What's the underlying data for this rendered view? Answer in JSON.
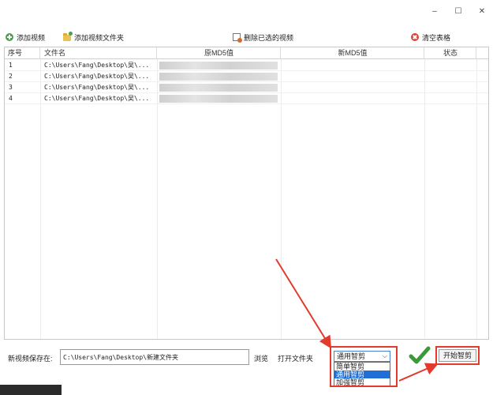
{
  "window": {
    "controls": {
      "minimize": "–",
      "maximize": "☐",
      "close": "✕"
    }
  },
  "toolbar": {
    "add_video": "添加视频",
    "add_folder": "添加视频文件夹",
    "delete_selected": "删除已选的视频",
    "clear_table": "清空表格"
  },
  "table": {
    "columns": [
      "序号",
      "文件名",
      "原MD5值",
      "新MD5值",
      "状态"
    ],
    "rows": [
      {
        "no": "1",
        "file": "C:\\Users\\Fang\\Desktop\\吴\\...",
        "new_md5": "",
        "status": ""
      },
      {
        "no": "2",
        "file": "C:\\Users\\Fang\\Desktop\\吴\\...",
        "new_md5": "",
        "status": ""
      },
      {
        "no": "3",
        "file": "C:\\Users\\Fang\\Desktop\\吴\\...",
        "new_md5": "",
        "status": ""
      },
      {
        "no": "4",
        "file": "C:\\Users\\Fang\\Desktop\\吴\\...",
        "new_md5": "",
        "status": ""
      }
    ]
  },
  "output": {
    "label": "新视频保存在:",
    "path": "C:\\Users\\Fang\\Desktop\\新建文件夹",
    "browse": "浏览",
    "open_folder": "打开文件夹"
  },
  "mode": {
    "selected": "通用智剪",
    "options": [
      "简单智剪",
      "通用智剪",
      "加强智剪"
    ],
    "highlighted_index": 1
  },
  "start": {
    "label": "开始智剪"
  },
  "colors": {
    "accent_red": "#e23b2e",
    "select_blue": "#1f6fd6",
    "check_green": "#3a9a3a"
  }
}
